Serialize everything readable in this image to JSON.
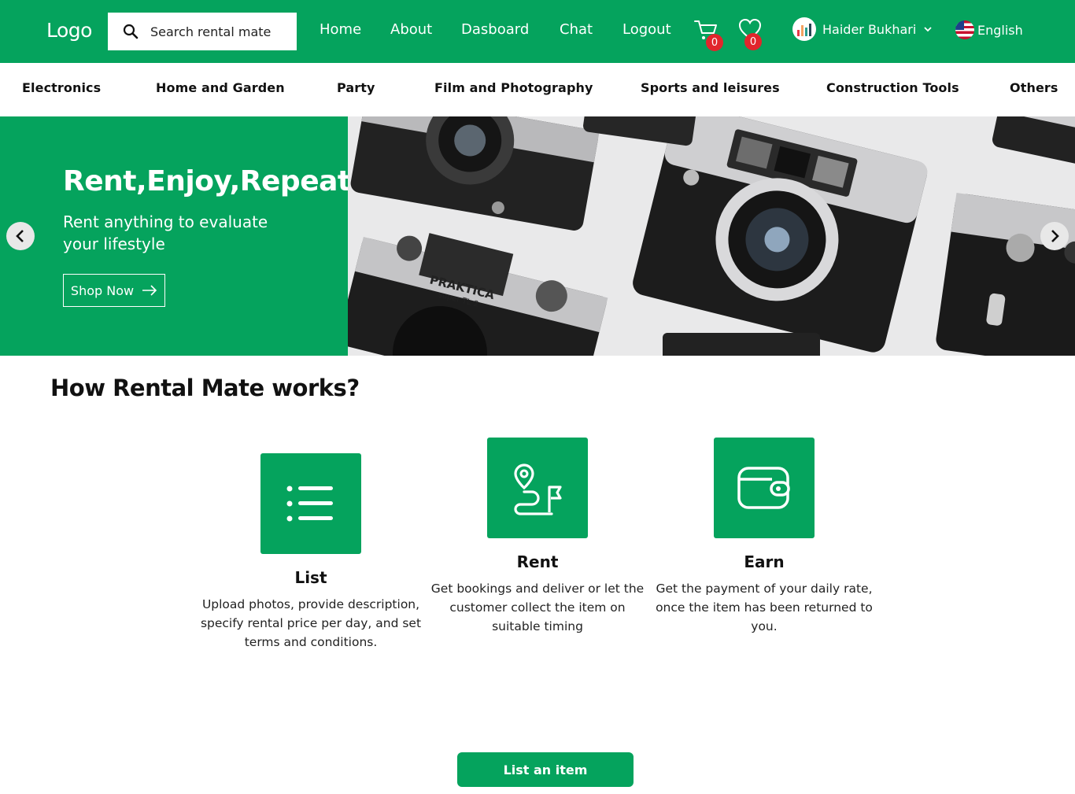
{
  "header": {
    "logo": "Logo",
    "search_placeholder": "Search rental mate",
    "nav": [
      "Home",
      "About",
      "Dasboard",
      "Chat",
      "Logout"
    ],
    "cart_count": "0",
    "wishlist_count": "0",
    "user_name": "Haider Bukhari",
    "language": "English"
  },
  "categories": [
    "Electronics",
    "Home and Garden",
    "Party",
    "Film and Photography",
    "Sports and leisures",
    "Construction Tools",
    "Others"
  ],
  "hero": {
    "title": "Rent,Enjoy,Repeat!",
    "subtitle": "Rent anything to evaluate your lifestyle",
    "cta": "Shop Now"
  },
  "how": {
    "title": "How Rental Mate works?",
    "steps": [
      {
        "title": "List",
        "icon": "list-icon",
        "desc": "Upload photos, provide description, specify rental price per day, and set terms and conditions."
      },
      {
        "title": "Rent",
        "icon": "route-icon",
        "desc": "Get bookings and deliver or let the customer collect the item on suitable timing"
      },
      {
        "title": "Earn",
        "icon": "wallet-icon",
        "desc": "Get the payment of your daily rate, once the item has been returned to you."
      }
    ]
  },
  "list_item_button": "List an item",
  "colors": {
    "brand": "#05a35d",
    "badge": "#e1262c"
  }
}
